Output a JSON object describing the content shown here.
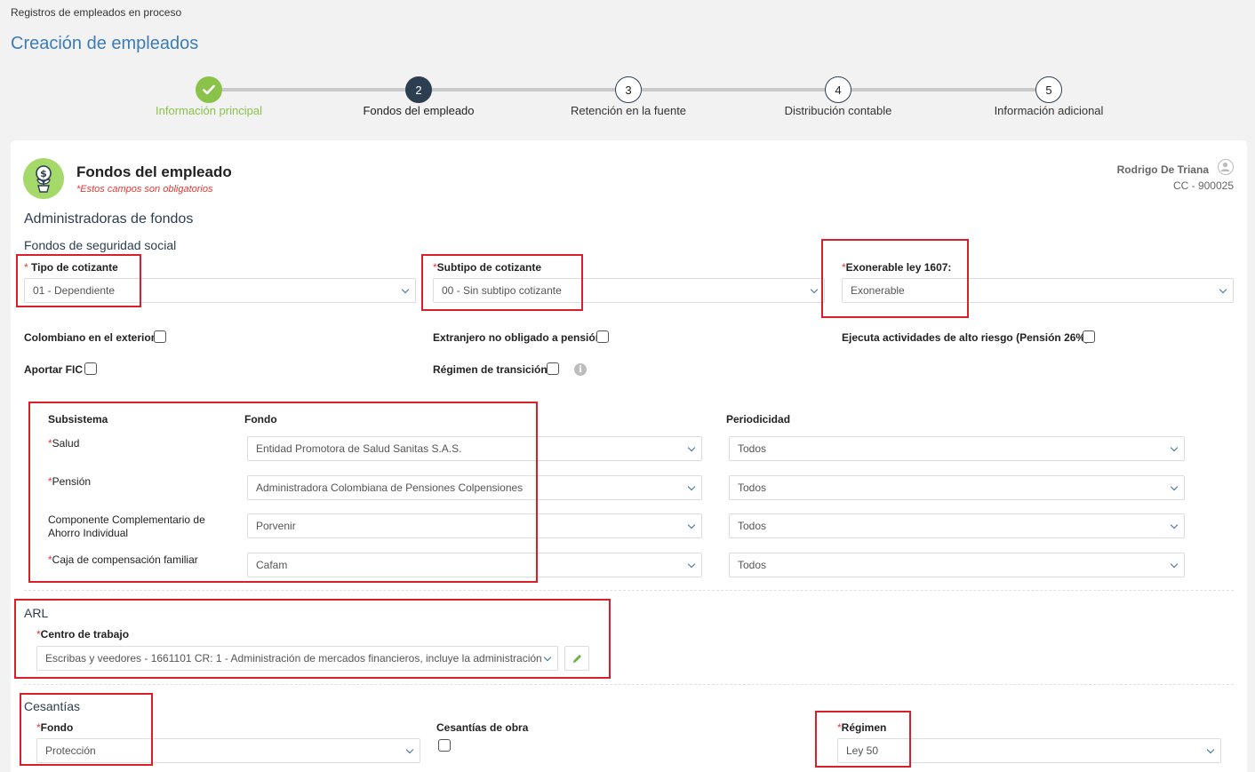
{
  "breadcrumb": "Registros de empleados en proceso",
  "page_title": "Creación de empleados",
  "steps": [
    {
      "num": "",
      "label": "Información principal",
      "state": "done"
    },
    {
      "num": "2",
      "label": "Fondos del empleado",
      "state": "active"
    },
    {
      "num": "3",
      "label": "Retención en la fuente",
      "state": "pending"
    },
    {
      "num": "4",
      "label": "Distribución contable",
      "state": "pending"
    },
    {
      "num": "5",
      "label": "Información adicional",
      "state": "pending"
    }
  ],
  "section": {
    "title": "Fondos del empleado",
    "required_note": "*Estos campos son obligatorios",
    "icon": "money-plant-icon"
  },
  "user": {
    "name": "Rodrigo De Triana",
    "doc": "CC - 900025"
  },
  "admin_heading": "Administradoras de fondos",
  "social_heading": "Fondos de seguridad social",
  "fields": {
    "tipo_cotizante": {
      "label": "Tipo de cotizante",
      "value": "01 - Dependiente"
    },
    "subtipo_cotizante": {
      "label": "Subtipo de cotizante",
      "value": "00 - Sin subtipo cotizante"
    },
    "exonerable": {
      "label": "Exonerable ley 1607:",
      "value": "Exonerable"
    }
  },
  "checkboxes": {
    "colombiano_exterior": "Colombiano en el exterior",
    "extranjero": "Extranjero no obligado a pensión",
    "alto_riesgo": "Ejecuta actividades de alto riesgo (Pensión 26%)",
    "aportar_fic": "Aportar FIC",
    "regimen_transicion": "Régimen de transición"
  },
  "funds_table": {
    "headers": {
      "subsistema": "Subsistema",
      "fondo": "Fondo",
      "periodicidad": "Periodicidad"
    },
    "rows": [
      {
        "subsistema": "Salud",
        "required": "*",
        "fondo": "Entidad Promotora de Salud Sanitas S.A.S.",
        "periodicidad": "Todos"
      },
      {
        "subsistema": "Pensión",
        "required": "*",
        "fondo": "Administradora Colombiana de Pensiones Colpensiones",
        "periodicidad": "Todos"
      },
      {
        "subsistema": "Componente Complementario de Ahorro Individual",
        "required": "",
        "fondo": "Porvenir",
        "periodicidad": "Todos"
      },
      {
        "subsistema": "Caja de compensación familiar",
        "required": "*",
        "fondo": "Cafam",
        "periodicidad": "Todos"
      }
    ]
  },
  "arl": {
    "heading": "ARL",
    "centro_label": "Centro de trabajo",
    "centro_value": "Escribas y veedores - 1661101 CR: 1 - Administración de mercados financieros, incluye la administración"
  },
  "cesantias": {
    "heading": "Cesantías",
    "fondo_label": "Fondo",
    "fondo_value": "Protección",
    "obra_label": "Cesantías de obra",
    "regimen_label": "Régimen",
    "regimen_value": "Ley 50"
  },
  "required_mark": "*",
  "info_glyph": "i",
  "colors": {
    "accent": "#3b7cb8",
    "done": "#8bc34a",
    "active": "#2c3e50",
    "highlight": "#d9202a",
    "required": "#e53935"
  }
}
